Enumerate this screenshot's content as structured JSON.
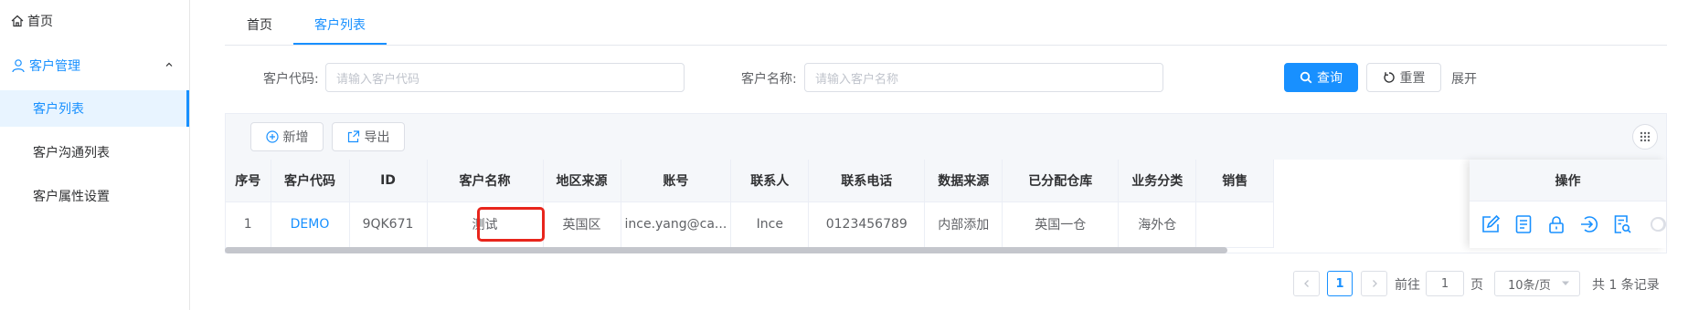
{
  "sidebar": {
    "home_label": "首页",
    "group_label": "客户管理",
    "items": [
      {
        "label": "客户列表"
      },
      {
        "label": "客户沟通列表"
      },
      {
        "label": "客户属性设置"
      }
    ]
  },
  "tabs": [
    {
      "label": "首页"
    },
    {
      "label": "客户列表"
    }
  ],
  "search": {
    "code_label": "客户代码:",
    "code_placeholder": "请输入客户代码",
    "name_label": "客户名称:",
    "name_placeholder": "请输入客户名称",
    "query_label": "查询",
    "reset_label": "重置",
    "expand_label": "展开"
  },
  "toolbar": {
    "add_label": "新增",
    "export_label": "导出"
  },
  "table": {
    "headers": [
      "序号",
      "客户代码",
      "ID",
      "客户名称",
      "地区来源",
      "账号",
      "联系人",
      "联系电话",
      "数据来源",
      "已分配仓库",
      "业务分类",
      "销售"
    ],
    "op_header": "操作",
    "rows": [
      [
        "1",
        "DEMO",
        "9QK671",
        "测试",
        "英国区",
        "ince.yang@ca...",
        "Ince",
        "0123456789",
        "内部添加",
        "英国一仓",
        "海外仓",
        ""
      ]
    ]
  },
  "pagination": {
    "current_page": "1",
    "goto_prefix": "前往",
    "goto_value": "1",
    "goto_suffix": "页",
    "page_size": "10条/页",
    "total": "共 1 条记录"
  },
  "colors": {
    "accent": "#1890ff",
    "highlight": "#e8251c"
  }
}
